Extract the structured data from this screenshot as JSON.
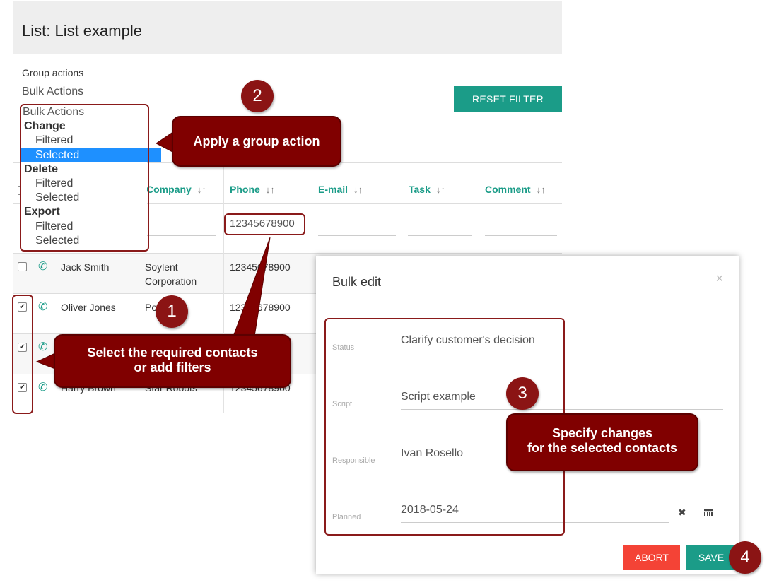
{
  "page": {
    "title": "List: List example"
  },
  "group_actions": {
    "label": "Group actions",
    "select_value": "Bulk Actions",
    "dropdown": {
      "header": "Bulk Actions",
      "groups": [
        {
          "label": "Change",
          "options": [
            "Filtered",
            "Selected"
          ]
        },
        {
          "label": "Delete",
          "options": [
            "Filtered",
            "Selected"
          ]
        },
        {
          "label": "Export",
          "options": [
            "Filtered",
            "Selected"
          ]
        }
      ],
      "selected": "Selected"
    }
  },
  "toolbar": {
    "reset_filter_label": "RESET FILTER"
  },
  "table": {
    "columns": [
      "Company",
      "Phone",
      "E-mail",
      "Task",
      "Comment"
    ],
    "sort_glyph": "↓↑",
    "phone_filter_value": "12345678900",
    "rows": [
      {
        "name": "Jack Smith",
        "company": "Soylent Corporation",
        "phone": "12345678900",
        "checked": false
      },
      {
        "name": "Oliver Jones",
        "company": "Portacho",
        "phone": "12345678900",
        "checked": true
      },
      {
        "name": "",
        "company": "",
        "phone": "",
        "checked": true
      },
      {
        "name": "Harry Brown",
        "company": "Star Robots",
        "phone": "12345678900",
        "checked": true
      }
    ]
  },
  "callouts": {
    "c1": {
      "number": "1",
      "text_line1": "Select the required contacts",
      "text_line2": "or add filters"
    },
    "c2": {
      "number": "2",
      "text": "Apply a group action"
    },
    "c3": {
      "number": "3",
      "text_line1": "Specify changes",
      "text_line2": "for the selected contacts"
    },
    "c4": {
      "number": "4"
    }
  },
  "modal": {
    "title": "Bulk edit",
    "close_glyph": "×",
    "fields": {
      "status": {
        "label": "Status",
        "value": "Clarify customer's decision"
      },
      "script": {
        "label": "Script",
        "value": "Script example"
      },
      "responsible": {
        "label": "Responsible",
        "value": "Ivan Rosello"
      },
      "planned": {
        "label": "Planned",
        "value": "2018-05-24"
      }
    },
    "clear_glyph": "✖",
    "abort_label": "ABORT",
    "save_label": "SAVE"
  },
  "colors": {
    "accent": "#1b9c88",
    "callout": "#800000",
    "abort": "#f44336",
    "selected_option": "#1e90ff"
  }
}
